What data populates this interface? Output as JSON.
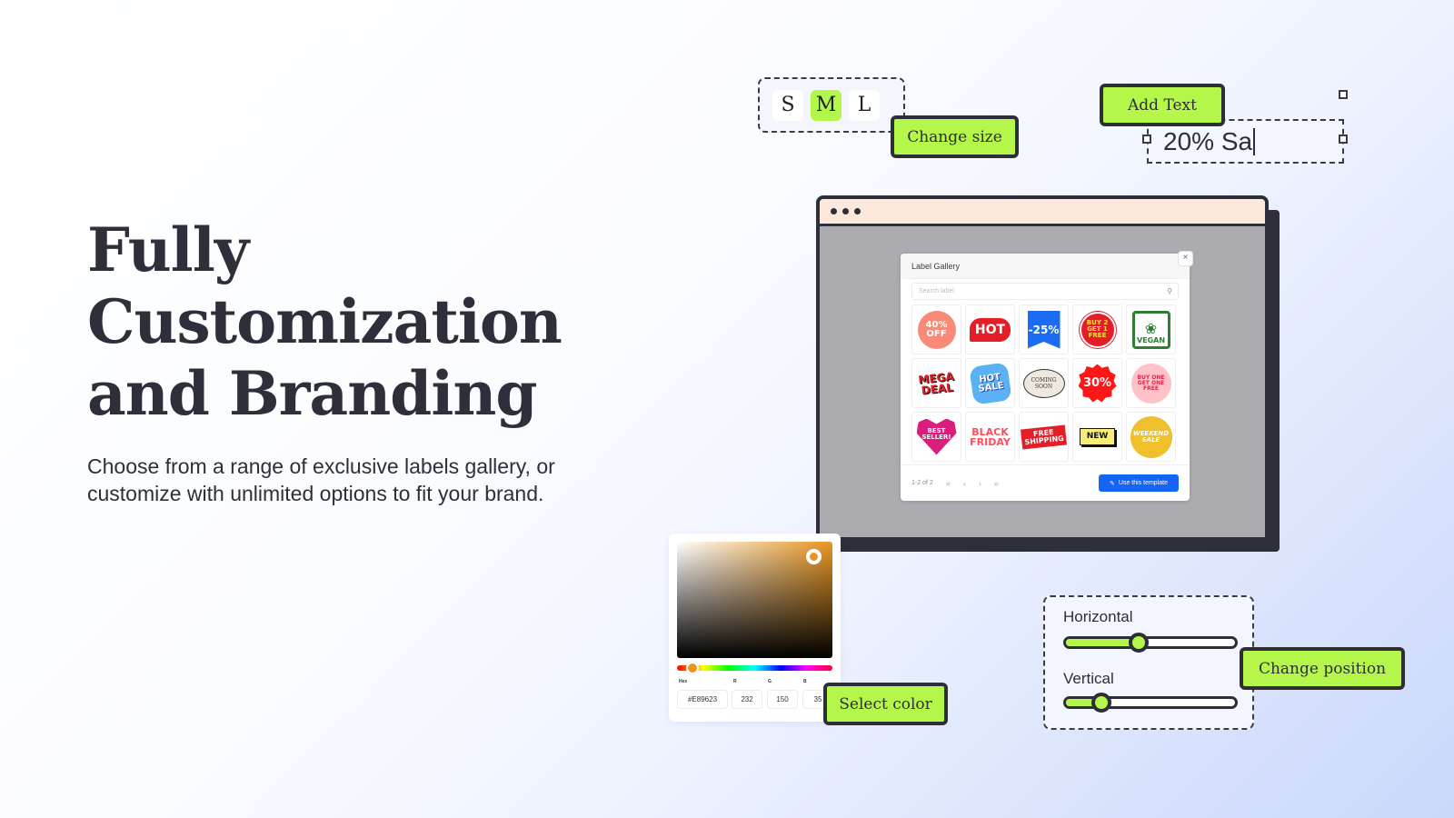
{
  "hero": {
    "headline_lines": [
      "Fully",
      "Customization",
      "and Branding"
    ],
    "subtext": "Choose from a range of exclusive labels gallery, or customize with unlimited options to fit your brand."
  },
  "size_picker": {
    "options": [
      {
        "label": "S",
        "selected": false
      },
      {
        "label": "M",
        "selected": true
      },
      {
        "label": "L",
        "selected": false
      }
    ],
    "tag": "Change size"
  },
  "add_text": {
    "tag": "Add Text",
    "value": "20% Sa"
  },
  "gallery": {
    "title": "Label Gallery",
    "close": "×",
    "search_placeholder": "Search label",
    "search_icon": "search-icon",
    "labels": [
      {
        "name": "40% OFF",
        "text": "40%\nOFF"
      },
      {
        "name": "HOT",
        "text": "HOT"
      },
      {
        "name": "-25%",
        "text": "-25%"
      },
      {
        "name": "BUY 2 GET 1 FREE",
        "text": "BUY 2\nGET 1\nFREE"
      },
      {
        "name": "VEGAN",
        "text": "VEGAN"
      },
      {
        "name": "MEGA DEAL",
        "text": "MEGA\nDEAL"
      },
      {
        "name": "HOT SALE",
        "text": "HOT\nSALE"
      },
      {
        "name": "COMING SOON",
        "text": "COMING\nSOON"
      },
      {
        "name": "30%",
        "text": "30%"
      },
      {
        "name": "BUY ONE GET ONE FREE",
        "text": "BUY ONE\nGET ONE\nFREE"
      },
      {
        "name": "BEST SELLER!",
        "text": "BEST\nSELLER!"
      },
      {
        "name": "BLACK FRIDAY",
        "text": "BLACK\nFRIDAY"
      },
      {
        "name": "FREE SHIPPING",
        "text": "FREE\nSHIPPING"
      },
      {
        "name": "NEW",
        "text": "NEW"
      },
      {
        "name": "WEEKEND SALE",
        "text": "WEEKEND\nSALE"
      }
    ],
    "pagination": {
      "range": "1-2 of 2",
      "first": "«",
      "prev": "‹",
      "next": "›",
      "last": "»"
    },
    "use_template": "Use this template"
  },
  "color_picker": {
    "tag": "Select color",
    "hex_label": "Hex",
    "r_label": "R",
    "g_label": "G",
    "b_label": "B",
    "hex": "#E89623",
    "r": "232",
    "g": "150",
    "b": "35"
  },
  "position": {
    "tag": "Change position",
    "horizontal_label": "Horizontal",
    "vertical_label": "Vertical",
    "horizontal_value": 0.43,
    "vertical_value": 0.21
  },
  "colors": {
    "accent_green": "#B4F74A",
    "dark": "#2D2E38",
    "primary_blue": "#1565F5",
    "window_bar": "#FDE9DB"
  }
}
